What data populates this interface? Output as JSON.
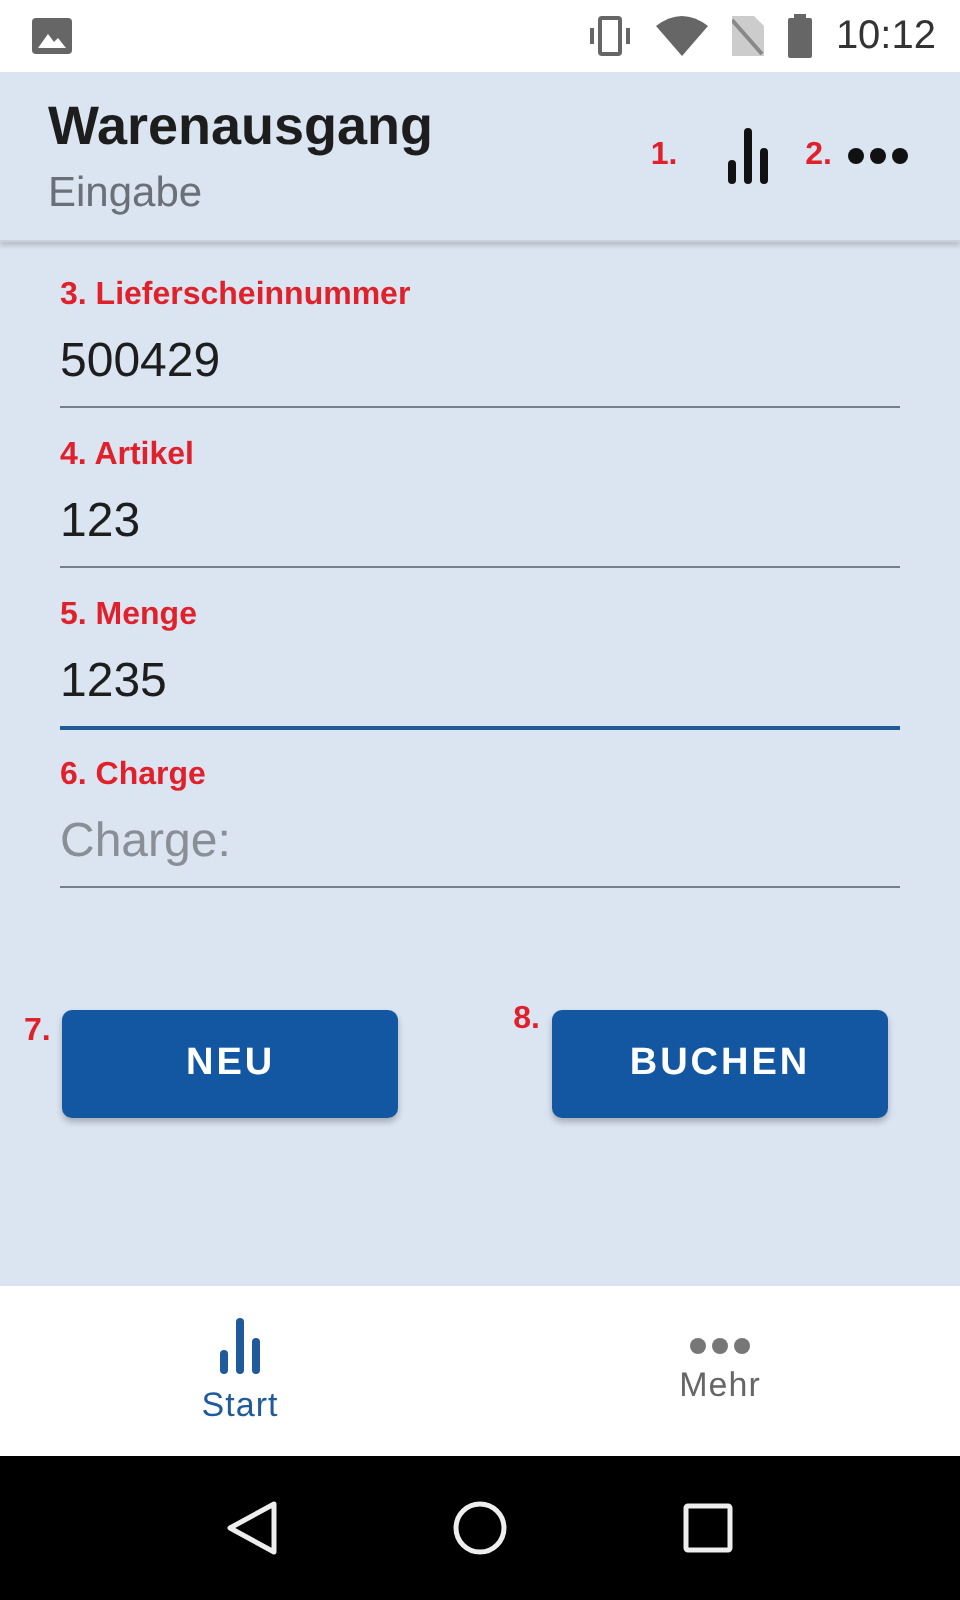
{
  "status_bar": {
    "time": "10:12"
  },
  "header": {
    "title": "Warenausgang",
    "subtitle": "Eingabe",
    "actions": [
      {
        "marker": "1.",
        "kind": "chart"
      },
      {
        "marker": "2.",
        "kind": "more"
      }
    ]
  },
  "fields": [
    {
      "label": "3. Lieferscheinnummer",
      "value": "500429",
      "focused": false
    },
    {
      "label": "4. Artikel",
      "value": "123",
      "focused": false
    },
    {
      "label": "5. Menge",
      "value": "1235",
      "focused": true
    },
    {
      "label": "6. Charge",
      "placeholder": "Charge:",
      "focused": false
    }
  ],
  "buttons": [
    {
      "marker": "7.",
      "label": "NEU"
    },
    {
      "marker": "8.",
      "label": "BUCHEN"
    }
  ],
  "bottom_nav": [
    {
      "kind": "chart",
      "label": "Start",
      "selected": true
    },
    {
      "kind": "more",
      "label": "Mehr",
      "selected": false
    }
  ]
}
